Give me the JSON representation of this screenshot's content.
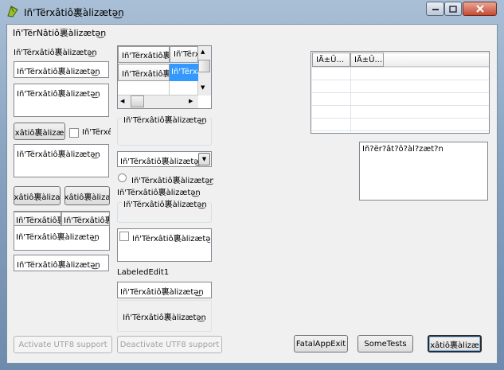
{
  "window": {
    "title": "Iñ'Tërxâtiô裏àlizætə͜n",
    "client_caption": "Iñ'TërNâtiô裏àlizætə͜n"
  },
  "left": {
    "label1": "Iñ'Tërxâtiô裏àlizætə͜n",
    "edit1": "Iñ'Tërxâtiô裏àlizætə͜n",
    "memo1": "Iñ'Tërxâtiô裏àlizætə͜n",
    "button1": "xâtiô裏àlizæ",
    "checkbox1": "Iñ'Tërxê",
    "memo2": "Iñ'Tërxâtiô裏àlizætə͜n",
    "button2": "xâtiô裏àliza",
    "button3": "xâtiô裏àliza",
    "tabs": [
      "Iñ'Tërxâtiô裏",
      "Iñ'Tërxâtiô裏"
    ],
    "tab_content": "Iñ'Tërxâtiô裏àlizætə͜n",
    "edit2": "Iñ'Tërxâtiô裏àlizætə͜n"
  },
  "mid": {
    "grid_cells": [
      [
        "Iñ'Tërxâtiô裏",
        "Iñ'Tërx"
      ],
      [
        "Iñ'Tërxâtiô裏",
        "Iñ'Tërxâ"
      ]
    ],
    "groupbox1_caption": "Iñ'Tërxâtiô裏àlizætə͜n",
    "combo_value": "Iñ'Tërxâtiô裏àlizætə͜n",
    "radio_label": "Iñ'Tërxâtiô裏àlizætə͜n",
    "static_label": "Iñ'Tërxâtiô裏àlizætə͜n",
    "groupbox2_caption": "Iñ'Tërxâtiô裏àlizætə͜n",
    "checkbox2": "Iñ'Tërxâtiô裏àlizætə͜n",
    "labeled_edit_caption": "LabeledEdit1",
    "labeled_edit_value": "Iñ'Tërxâtiô裏àlizætə͜n",
    "static_box": "Iñ'Tërxâtiô裏àlizætə͜n"
  },
  "right": {
    "list_headers": [
      "IÃ±Û...",
      "IÃ±Û..."
    ],
    "memo3": "Iñ?ër?ât?ô?àl?zæt?n"
  },
  "buttons": {
    "activate": "Activate UTF8 support",
    "deactivate": "Deactivate UTF8 support",
    "fatal": "FatalAppExit",
    "tests": "SomeTests",
    "last": "xâtiô裏àlizæ"
  }
}
